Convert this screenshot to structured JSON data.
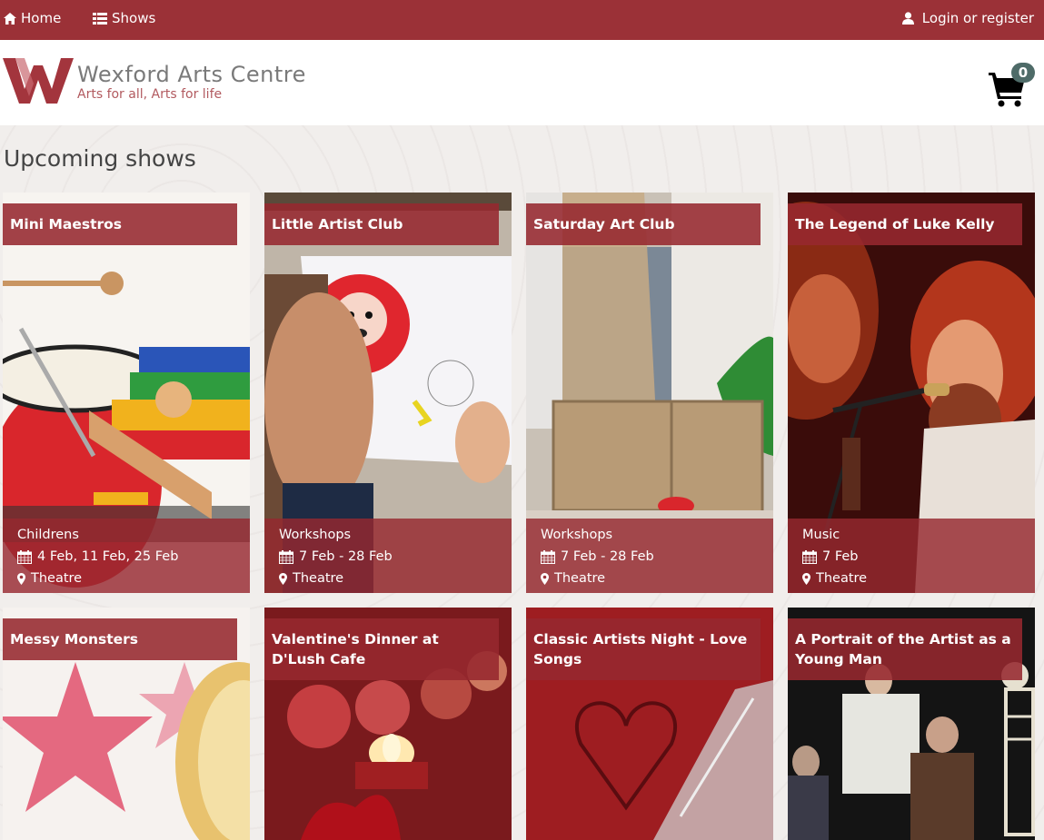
{
  "nav": {
    "home_label": "Home",
    "shows_label": "Shows",
    "login_label": "Login or register",
    "icons": {
      "home": "home-icon",
      "shows": "list-icon",
      "login": "user-icon"
    },
    "bg_color": "#9b3137"
  },
  "header": {
    "logo_title": "Wexford Arts Centre",
    "logo_tagline": "Arts for all, Arts for life",
    "cart_count": "0",
    "cart_icon": "shopping-cart-icon"
  },
  "page_title": "Upcoming shows",
  "shows": [
    {
      "title": "Mini Maestros",
      "category": "Childrens",
      "dates": "4 Feb, 11 Feb, 25 Feb",
      "venue": "Theatre"
    },
    {
      "title": "Little Artist Club",
      "category": "Workshops",
      "dates": "7 Feb - 28 Feb",
      "venue": "Theatre"
    },
    {
      "title": "Saturday Art Club",
      "category": "Workshops",
      "dates": "7 Feb - 28 Feb",
      "venue": "Theatre"
    },
    {
      "title": "The Legend of Luke Kelly",
      "category": "Music",
      "dates": "7 Feb",
      "venue": "Theatre"
    },
    {
      "title": "Messy Monsters"
    },
    {
      "title": "Valentine's Dinner at D'Lush Cafe"
    },
    {
      "title": "Classic Artists Night - Love Songs"
    },
    {
      "title": "A Portrait of the Artist as a Young Man"
    }
  ],
  "colors": {
    "accent": "#9b3137",
    "card_overlay": "#962830",
    "badge": "#4e6b68"
  }
}
